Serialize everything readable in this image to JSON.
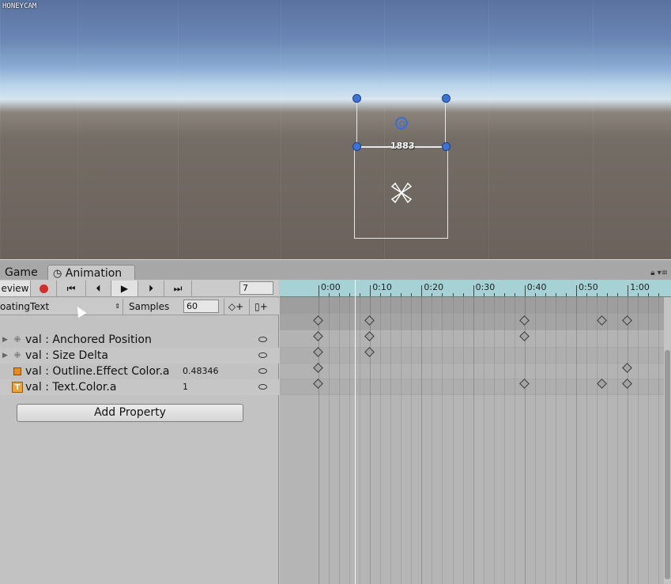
{
  "watermark": "HONEYCAM",
  "scene": {
    "counter_text": "1883"
  },
  "tabs": [
    {
      "label": "Game"
    },
    {
      "label": "Animation"
    }
  ],
  "toolbar": {
    "preview_label": "eview",
    "frame_value": "7"
  },
  "clip": {
    "name": "oatingText",
    "samples_label": "Samples",
    "samples_value": "60"
  },
  "properties": [
    {
      "name": "val : Anchored Position",
      "value": "",
      "icon": "rect-transform-icon",
      "expandable": true
    },
    {
      "name": "val : Size Delta",
      "value": "",
      "icon": "rect-transform-icon",
      "expandable": true
    },
    {
      "name": "val : Outline.Effect Color.a",
      "value": "0.48346",
      "icon": "outline-component-icon",
      "expandable": false
    },
    {
      "name": "val : Text.Color.a",
      "value": "1",
      "icon": "text-component-icon",
      "expandable": false
    }
  ],
  "add_property_label": "Add Property",
  "timeline": {
    "ticks": [
      "0:00",
      "0:10",
      "0:20",
      "0:30",
      "0:40",
      "0:50",
      "1:00"
    ],
    "current_frame": 7,
    "keyframes": {
      "summary": [
        0,
        10,
        40,
        55,
        60
      ],
      "anchored_position": [
        0,
        10,
        40
      ],
      "size_delta": [
        0,
        10
      ],
      "outline_color_a": [
        0,
        60
      ],
      "text_color_a": [
        0,
        40,
        55,
        60
      ]
    }
  },
  "colors": {
    "ruler_bg": "#a6d1d5",
    "record_red": "#d32d2d",
    "handle_blue": "#3b74d4"
  }
}
